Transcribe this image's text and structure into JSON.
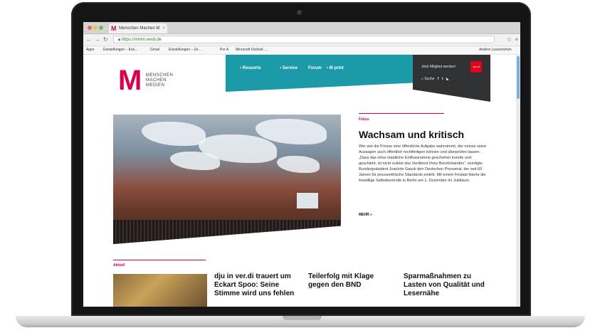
{
  "browser": {
    "tab_title": "Menschen Machen M",
    "tab_favicon": "M",
    "url": "https://mmm.verdi.de",
    "bookmarks": [
      "Apps",
      "Einstellungen – Erw…",
      "Gmail",
      "Einstellungen – Ze…",
      "Per A",
      "Microsoft Outlook …",
      "Andere Lesezeichen"
    ]
  },
  "site": {
    "logo_letter": "M",
    "logo_lines": [
      "MENSCHEN",
      "MACHEN",
      "MEDIEN"
    ],
    "nav": [
      "Ressorts",
      "Service",
      "Forum",
      "M print"
    ],
    "top_right": "Jetzt Mitglied werden!",
    "verdi_label": "ver.di",
    "search_label": "Suche",
    "social": [
      "f",
      "t",
      "rss"
    ]
  },
  "hero": {
    "kicker": "Fokus",
    "headline": "Wachsam und kritisch",
    "teaser": "Wer wie die Presse eine öffentliche Aufgabe wahrnimmt, der müsse seine Aussagen auch öffentlich rechtfertigen können und überprüfen lassen. „Dass das ohne staatliche Einflussnahme geschehen konnte und geschieht, ist nicht zuletzt das Verdienst Ihres Berufsstandes“, würdigte Bundespräsident Joachim Gauck den Deutschen Presserat, der seit 60 Jahren für presseethische Standards eintritt. Mit einem Festakt feierte die freiwillige Selbstkontrolle in Berlin am 1. Dezember ihr Jubiläum.",
    "more": "MEHR »"
  },
  "aktuell": {
    "kicker": "Aktuell",
    "stories": [
      "dju in ver.di trauert um Eckart Spoo: Seine Stimme wird uns fehlen",
      "Teilerfolg mit Klage gegen den BND",
      "Sparmaßnahmen zu Lasten von Qualität und Lesernähe"
    ]
  }
}
